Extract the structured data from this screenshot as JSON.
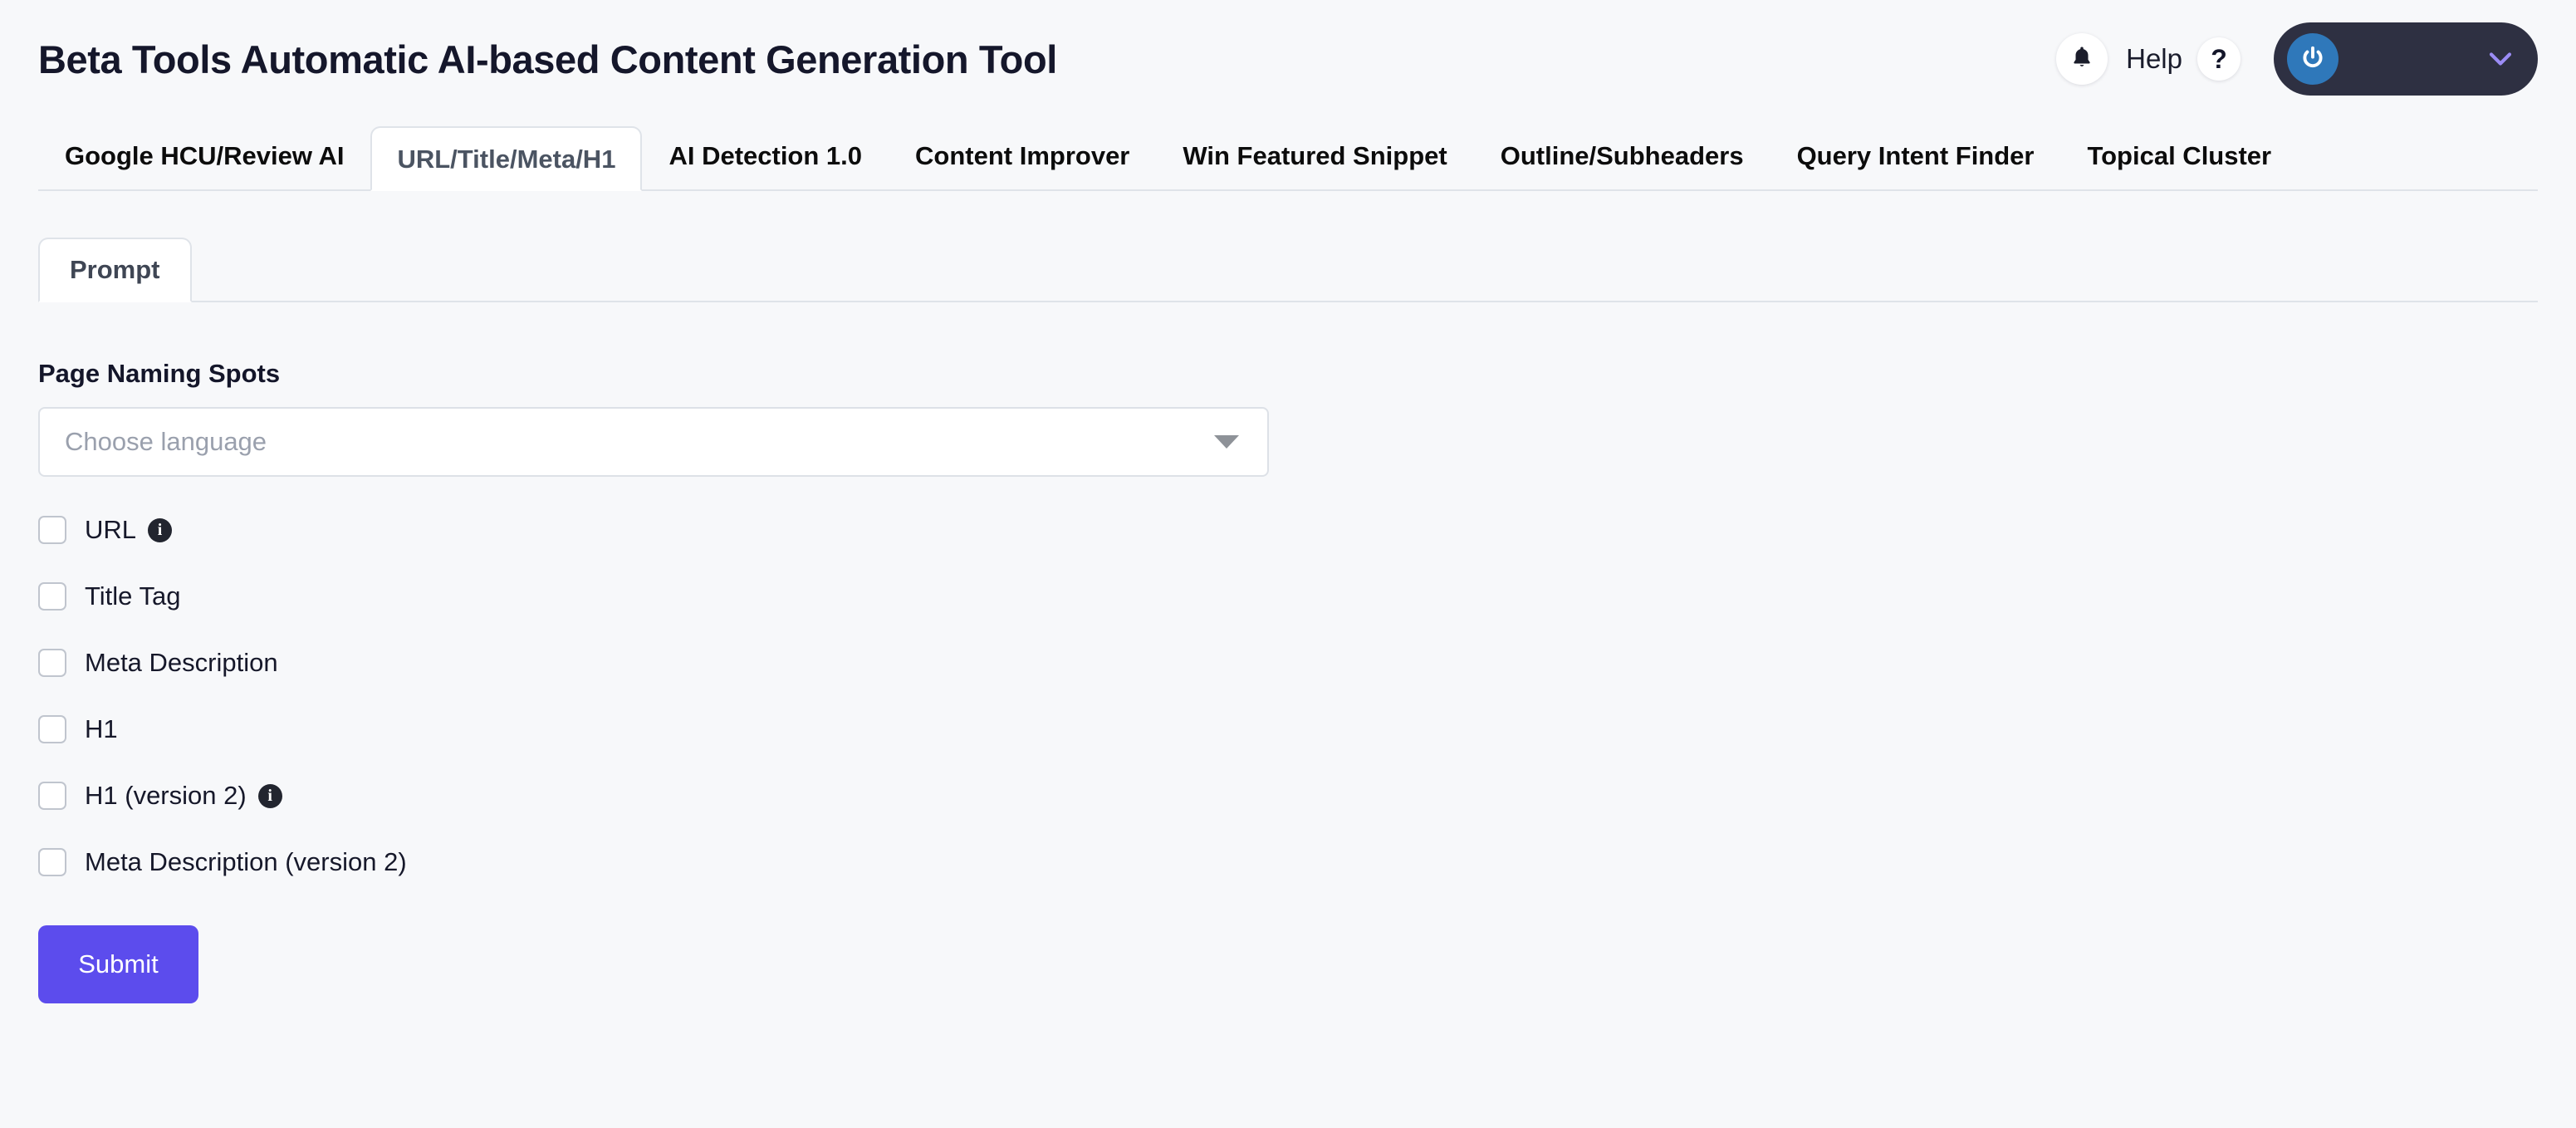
{
  "header": {
    "title": "Beta Tools Automatic AI-based Content Generation Tool",
    "notifications_icon": "bell-icon",
    "help_label": "Help",
    "help_icon_glyph": "?",
    "account_power_icon": "power-icon",
    "account_chevron_icon": "chevron-down-icon",
    "colors": {
      "title_text": "#15172b",
      "account_pill_bg": "#2e3042",
      "power_badge_bg": "#2f78ba",
      "chevron": "#9b8cf5"
    }
  },
  "tabs": {
    "active_index": 1,
    "items": [
      {
        "label": "Google HCU/Review AI"
      },
      {
        "label": "URL/Title/Meta/H1"
      },
      {
        "label": "AI Detection 1.0"
      },
      {
        "label": "Content Improver"
      },
      {
        "label": "Win Featured Snippet"
      },
      {
        "label": "Outline/Subheaders"
      },
      {
        "label": "Query Intent Finder"
      },
      {
        "label": "Topical Cluster"
      }
    ]
  },
  "subtabs": {
    "active_index": 0,
    "items": [
      {
        "label": "Prompt"
      }
    ]
  },
  "form": {
    "section_label": "Page Naming Spots",
    "language_select": {
      "placeholder": "Choose language",
      "value": "",
      "caret_icon": "chevron-down-icon"
    },
    "checkboxes": [
      {
        "label": "URL",
        "checked": false,
        "info": true
      },
      {
        "label": "Title Tag",
        "checked": false,
        "info": false
      },
      {
        "label": "Meta Description",
        "checked": false,
        "info": false
      },
      {
        "label": "H1",
        "checked": false,
        "info": false
      },
      {
        "label": "H1 (version 2)",
        "checked": false,
        "info": true
      },
      {
        "label": "Meta Description (version 2)",
        "checked": false,
        "info": false
      }
    ],
    "submit_label": "Submit",
    "submit_color": "#5c4ced"
  }
}
